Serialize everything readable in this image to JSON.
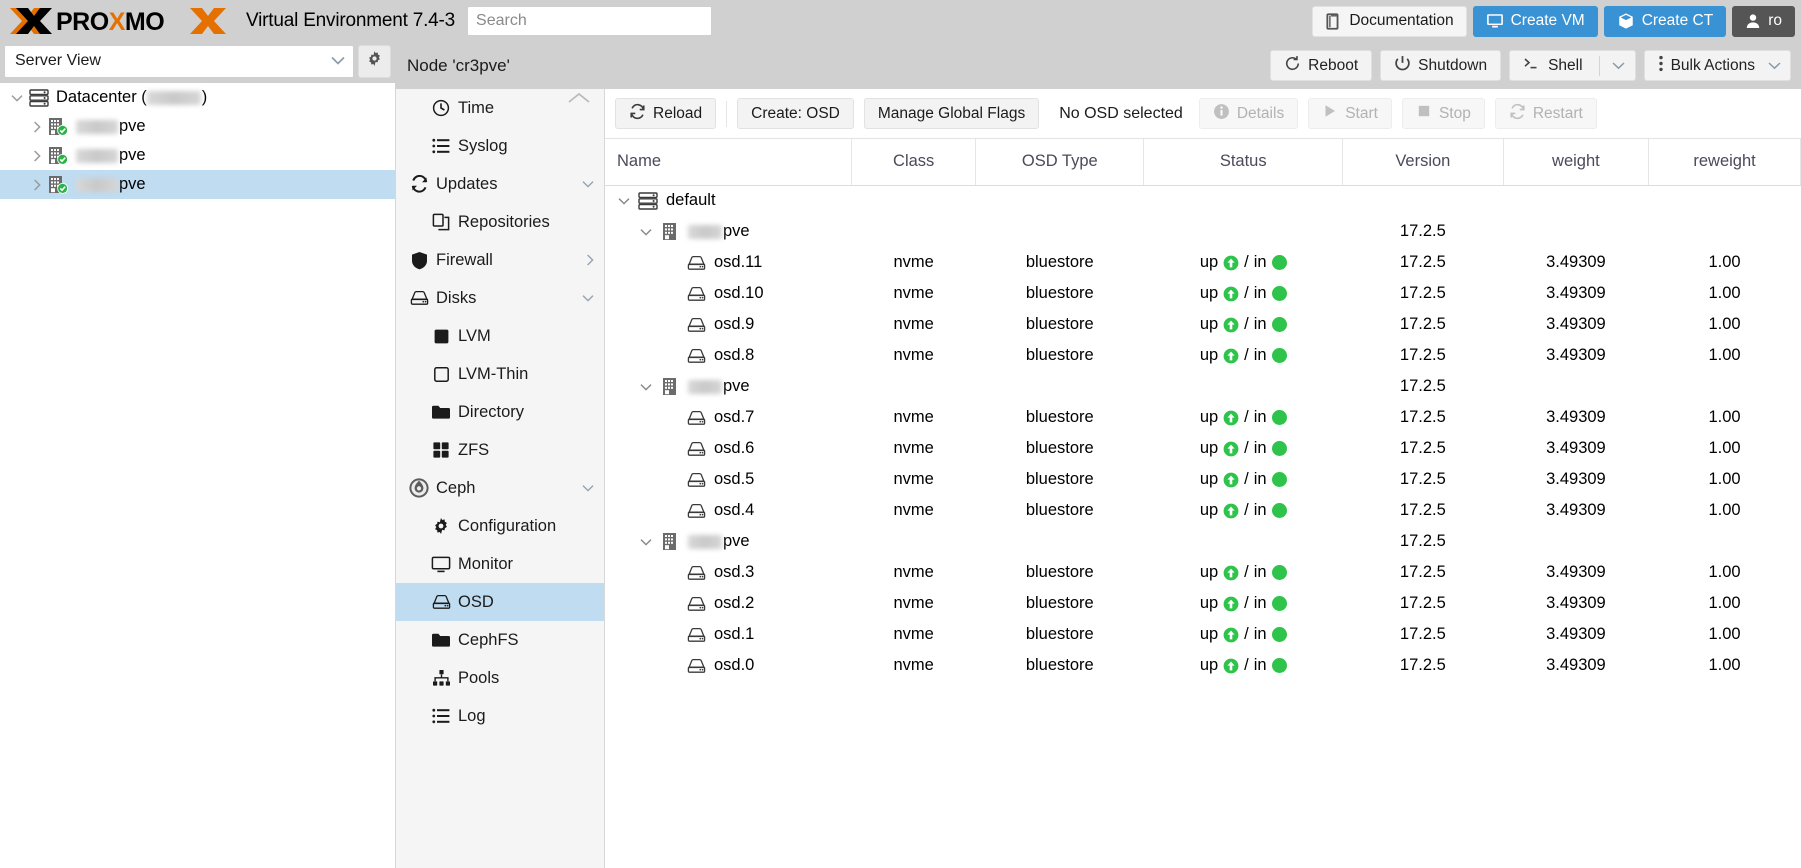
{
  "topbar": {
    "brand": "PROXMOX",
    "product": "Virtual Environment 7.4-3",
    "search_placeholder": "Search",
    "search_value": "",
    "documentation_label": "Documentation",
    "create_vm_label": "Create VM",
    "create_ct_label": "Create CT",
    "user_label": "ro",
    "accent_orange": "#e57000",
    "accent_blue": "#3892d4"
  },
  "sidebar": {
    "view_label": "Server View",
    "tree": [
      {
        "label": "Datacenter (",
        "suffix": ")",
        "redacted": true,
        "level": 0,
        "icon": "datacenter-icon",
        "expanded": true,
        "selected": false
      },
      {
        "label": "pve",
        "level": 1,
        "icon": "node-ok-icon",
        "expanded": false,
        "selected": false,
        "redacted": true
      },
      {
        "label": "pve",
        "level": 1,
        "icon": "node-ok-icon",
        "expanded": false,
        "selected": false,
        "redacted": true
      },
      {
        "label": "pve",
        "level": 1,
        "icon": "node-ok-icon",
        "expanded": false,
        "selected": true,
        "redacted": true
      }
    ]
  },
  "node_header": {
    "title": "Node 'cr3pve'",
    "reboot_label": "Reboot",
    "shutdown_label": "Shutdown",
    "shell_label": "Shell",
    "bulk_actions_label": "Bulk Actions"
  },
  "nav": {
    "items": [
      {
        "label": "Time",
        "icon": "clock-icon",
        "level": 1,
        "selected": false,
        "arrow": ""
      },
      {
        "label": "Syslog",
        "icon": "list-icon",
        "level": 1,
        "selected": false,
        "arrow": ""
      },
      {
        "label": "Updates",
        "icon": "refresh-icon",
        "level": 0,
        "selected": false,
        "arrow": "down"
      },
      {
        "label": "Repositories",
        "icon": "repos-icon",
        "level": 1,
        "selected": false,
        "arrow": ""
      },
      {
        "label": "Firewall",
        "icon": "shield-icon",
        "level": 0,
        "selected": false,
        "arrow": "right"
      },
      {
        "label": "Disks",
        "icon": "disk-icon",
        "level": 0,
        "selected": false,
        "arrow": "down"
      },
      {
        "label": "LVM",
        "icon": "lvm-icon",
        "level": 1,
        "selected": false,
        "arrow": ""
      },
      {
        "label": "LVM-Thin",
        "icon": "lvmthin-icon",
        "level": 1,
        "selected": false,
        "arrow": ""
      },
      {
        "label": "Directory",
        "icon": "folder-icon",
        "level": 1,
        "selected": false,
        "arrow": ""
      },
      {
        "label": "ZFS",
        "icon": "zfs-icon",
        "level": 1,
        "selected": false,
        "arrow": ""
      },
      {
        "label": "Ceph",
        "icon": "ceph-icon",
        "level": 0,
        "selected": false,
        "arrow": "down"
      },
      {
        "label": "Configuration",
        "icon": "gear-icon",
        "level": 1,
        "selected": false,
        "arrow": ""
      },
      {
        "label": "Monitor",
        "icon": "monitor-icon",
        "level": 1,
        "selected": false,
        "arrow": ""
      },
      {
        "label": "OSD",
        "icon": "disk-icon",
        "level": 1,
        "selected": true,
        "arrow": ""
      },
      {
        "label": "CephFS",
        "icon": "folder-icon",
        "level": 1,
        "selected": false,
        "arrow": ""
      },
      {
        "label": "Pools",
        "icon": "pools-icon",
        "level": 1,
        "selected": false,
        "arrow": ""
      },
      {
        "label": "Log",
        "icon": "list-icon",
        "level": 1,
        "selected": false,
        "arrow": ""
      }
    ]
  },
  "osd": {
    "toolbar": {
      "reload_label": "Reload",
      "create_osd_label": "Create: OSD",
      "manage_flags_label": "Manage Global Flags",
      "selection_label": "No OSD selected",
      "details_label": "Details",
      "start_label": "Start",
      "stop_label": "Stop",
      "restart_label": "Restart"
    },
    "columns": [
      "Name",
      "Class",
      "OSD Type",
      "Status",
      "Version",
      "weight",
      "reweight"
    ],
    "rows": [
      {
        "level": 0,
        "icon": "root-icon",
        "twisty": "down",
        "name": "default",
        "class": "",
        "osd_type": "",
        "status": "",
        "version": "",
        "weight": "",
        "reweight": ""
      },
      {
        "level": 1,
        "icon": "host-icon",
        "twisty": "down",
        "name": "pve",
        "redacted": true,
        "class": "",
        "osd_type": "",
        "status": "",
        "version": "17.2.5",
        "weight": "",
        "reweight": ""
      },
      {
        "level": 2,
        "icon": "osd-icon",
        "twisty": "",
        "name": "osd.11",
        "class": "nvme",
        "osd_type": "bluestore",
        "status": "up / in",
        "version": "17.2.5",
        "weight": "3.49309",
        "reweight": "1.00"
      },
      {
        "level": 2,
        "icon": "osd-icon",
        "twisty": "",
        "name": "osd.10",
        "class": "nvme",
        "osd_type": "bluestore",
        "status": "up / in",
        "version": "17.2.5",
        "weight": "3.49309",
        "reweight": "1.00"
      },
      {
        "level": 2,
        "icon": "osd-icon",
        "twisty": "",
        "name": "osd.9",
        "class": "nvme",
        "osd_type": "bluestore",
        "status": "up / in",
        "version": "17.2.5",
        "weight": "3.49309",
        "reweight": "1.00"
      },
      {
        "level": 2,
        "icon": "osd-icon",
        "twisty": "",
        "name": "osd.8",
        "class": "nvme",
        "osd_type": "bluestore",
        "status": "up / in",
        "version": "17.2.5",
        "weight": "3.49309",
        "reweight": "1.00"
      },
      {
        "level": 1,
        "icon": "host-icon",
        "twisty": "down",
        "name": "pve",
        "redacted": true,
        "class": "",
        "osd_type": "",
        "status": "",
        "version": "17.2.5",
        "weight": "",
        "reweight": ""
      },
      {
        "level": 2,
        "icon": "osd-icon",
        "twisty": "",
        "name": "osd.7",
        "class": "nvme",
        "osd_type": "bluestore",
        "status": "up / in",
        "version": "17.2.5",
        "weight": "3.49309",
        "reweight": "1.00"
      },
      {
        "level": 2,
        "icon": "osd-icon",
        "twisty": "",
        "name": "osd.6",
        "class": "nvme",
        "osd_type": "bluestore",
        "status": "up / in",
        "version": "17.2.5",
        "weight": "3.49309",
        "reweight": "1.00"
      },
      {
        "level": 2,
        "icon": "osd-icon",
        "twisty": "",
        "name": "osd.5",
        "class": "nvme",
        "osd_type": "bluestore",
        "status": "up / in",
        "version": "17.2.5",
        "weight": "3.49309",
        "reweight": "1.00"
      },
      {
        "level": 2,
        "icon": "osd-icon",
        "twisty": "",
        "name": "osd.4",
        "class": "nvme",
        "osd_type": "bluestore",
        "status": "up / in",
        "version": "17.2.5",
        "weight": "3.49309",
        "reweight": "1.00"
      },
      {
        "level": 1,
        "icon": "host-icon",
        "twisty": "down",
        "name": "pve",
        "redacted": true,
        "class": "",
        "osd_type": "",
        "status": "",
        "version": "17.2.5",
        "weight": "",
        "reweight": ""
      },
      {
        "level": 2,
        "icon": "osd-icon",
        "twisty": "",
        "name": "osd.3",
        "class": "nvme",
        "osd_type": "bluestore",
        "status": "up / in",
        "version": "17.2.5",
        "weight": "3.49309",
        "reweight": "1.00"
      },
      {
        "level": 2,
        "icon": "osd-icon",
        "twisty": "",
        "name": "osd.2",
        "class": "nvme",
        "osd_type": "bluestore",
        "status": "up / in",
        "version": "17.2.5",
        "weight": "3.49309",
        "reweight": "1.00"
      },
      {
        "level": 2,
        "icon": "osd-icon",
        "twisty": "",
        "name": "osd.1",
        "class": "nvme",
        "osd_type": "bluestore",
        "status": "up / in",
        "version": "17.2.5",
        "weight": "3.49309",
        "reweight": "1.00"
      },
      {
        "level": 2,
        "icon": "osd-icon",
        "twisty": "",
        "name": "osd.0",
        "class": "nvme",
        "osd_type": "bluestore",
        "status": "up / in",
        "version": "17.2.5",
        "weight": "3.49309",
        "reweight": "1.00"
      }
    ]
  }
}
